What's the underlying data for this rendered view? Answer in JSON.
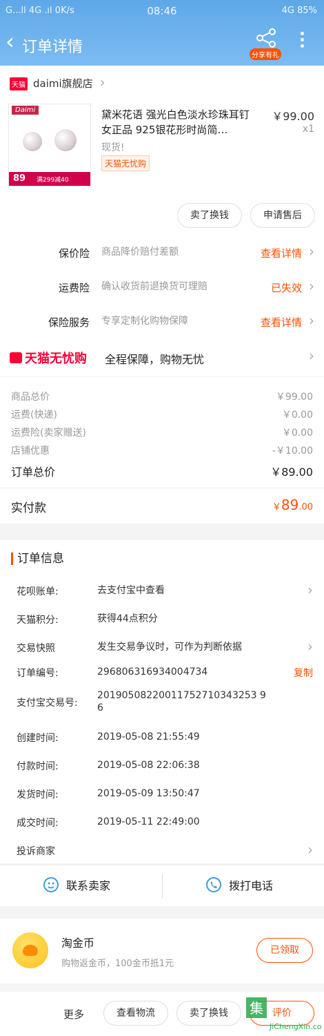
{
  "status": {
    "left": "G...ll 4G .ıl 0K/s",
    "time": "08:46",
    "right": "4G 85%"
  },
  "nav": {
    "title": "订单详情",
    "share_label": "分享有礼"
  },
  "store": {
    "badge": "天猫",
    "name": "daimi旗舰店"
  },
  "product": {
    "title": "黛米花语 强光白色淡水珍珠耳钉 女正品 925银花形时尚简…",
    "price": "￥99.00",
    "qty": "x1",
    "stock": "现货!",
    "tag": "天猫无忧购",
    "thumb": {
      "brand": "Daimi",
      "price": "89",
      "promo": "满299减40"
    }
  },
  "actions": {
    "sell": "卖了换钱",
    "after_sale": "申请售后"
  },
  "insurance": [
    {
      "key": "保价险",
      "desc": "商品降价赔付差额",
      "action": "查看详情"
    },
    {
      "key": "运费险",
      "desc": "确认收货前退换货可理赔",
      "action": "已失效"
    },
    {
      "key": "保险服务",
      "desc": "专享定制化购物保障",
      "action": "查看详情"
    }
  ],
  "worry": {
    "logo": "天猫无忧购",
    "text": "全程保障，购物无忧"
  },
  "fees": [
    {
      "key": "商品总价",
      "value": "￥99.00"
    },
    {
      "key": "运费(快递)",
      "value": "￥0.00"
    },
    {
      "key": "运费险(卖家赠送)",
      "value": "￥0.00"
    },
    {
      "key": "店铺优惠",
      "value": "-￥10.00"
    }
  ],
  "order_total": {
    "key": "订单总价",
    "value": "￥89.00"
  },
  "paid": {
    "key": "实付款",
    "currency": "￥",
    "amount": "89",
    "decimal": ".00"
  },
  "info": {
    "heading": "订单信息",
    "huabei": {
      "key": "花呗账单:",
      "value": "去支付宝中查看"
    },
    "points": {
      "key": "天猫积分:",
      "value": "获得44点积分"
    },
    "snapshot": {
      "key": "交易快照",
      "value": "发生交易争议时，可作为判断依据"
    },
    "order_no": {
      "key": "订单编号:",
      "value": "296806316934004734",
      "copy": "复制"
    },
    "alipay_no": {
      "key": "支付宝交易号:",
      "value": "20190508220011752710343253 96"
    },
    "created": {
      "key": "创建时间:",
      "value": "2019-05-08 21:55:49"
    },
    "paid_time": {
      "key": "付款时间:",
      "value": "2019-05-08 22:06:38"
    },
    "shipped": {
      "key": "发货时间:",
      "value": "2019-05-09 13:50:47"
    },
    "completed": {
      "key": "成交时间:",
      "value": "2019-05-11 22:49:00"
    },
    "complaint": "投诉商家"
  },
  "contact": {
    "seller": "联系卖家",
    "phone": "拨打电话"
  },
  "coin": {
    "title": "淘金币",
    "desc": "购物返金币，100金币抵1元",
    "button": "已领取"
  },
  "bottom": {
    "more": "更多",
    "logistics": "查看物流",
    "sell": "卖了换钱",
    "evaluate": "评价"
  },
  "watermark": {
    "text": "集 JiChengXin.com"
  },
  "colors": {
    "accent": "#ff5000",
    "header": "#6aaeed",
    "tmall": "#ff0036"
  }
}
